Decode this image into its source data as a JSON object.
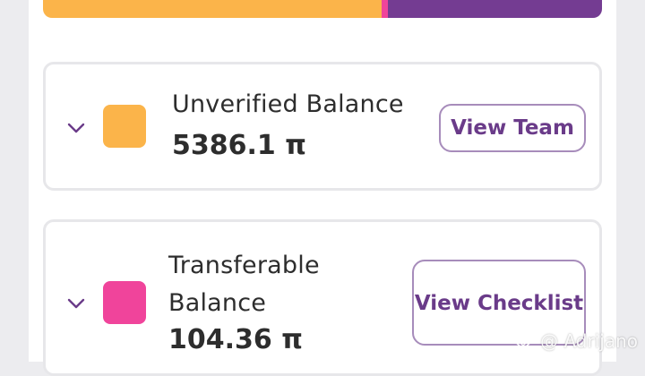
{
  "progress": {
    "colors": {
      "unverified": "#fbb44a",
      "transferable": "#f0449b",
      "remaining": "#743c92"
    },
    "fractions": {
      "unverified": 0.606,
      "transferable": 0.011
    }
  },
  "cards": [
    {
      "label": "Unverified Balance",
      "amount": "5386.1 π",
      "button": "View Team",
      "swatch_color": "#fbb44a",
      "icon": "chevron-down-icon"
    },
    {
      "label": "Transferable Balance",
      "amount": "104.36 π",
      "button": "View Checklist",
      "swatch_color": "#f0449b",
      "icon": "chevron-down-icon"
    }
  ],
  "watermark": {
    "text": "@ Adrijano",
    "icon": "logo-icon"
  }
}
